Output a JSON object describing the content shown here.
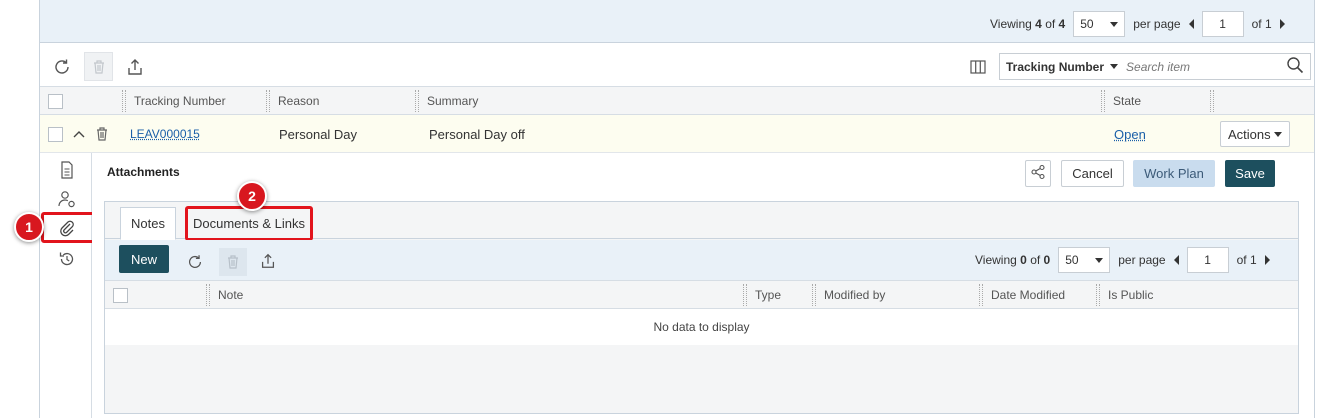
{
  "top_pager": {
    "viewing_prefix": "Viewing",
    "viewing_count": "4",
    "viewing_of": "of",
    "viewing_total": "4",
    "page_size": "50",
    "per_page": "per page",
    "page_number": "1",
    "of_pages": "of 1"
  },
  "search": {
    "field": "Tracking Number",
    "placeholder": "Search item"
  },
  "grid": {
    "columns": [
      "Tracking Number",
      "Reason",
      "Summary",
      "State"
    ],
    "rows": [
      {
        "tracking_number": "LEAV000015",
        "reason": "Personal Day",
        "summary": "Personal Day off",
        "state": "Open",
        "actions": "Actions"
      }
    ]
  },
  "detail": {
    "section_title": "Attachments",
    "cancel_label": "Cancel",
    "work_plan_label": "Work Plan",
    "save_label": "Save",
    "tabs": [
      "Notes",
      "Documents & Links"
    ],
    "new_label": "New",
    "pager": {
      "viewing_prefix": "Viewing",
      "viewing_count": "0",
      "viewing_of": "of",
      "viewing_total": "0",
      "page_size": "50",
      "per_page": "per page",
      "page_number": "1",
      "of_pages": "of 1"
    },
    "columns": [
      "Note",
      "Type",
      "Modified by",
      "Date Modified",
      "Is Public"
    ],
    "empty_text": "No data to display"
  },
  "callouts": [
    "1",
    "2"
  ],
  "colors": {
    "accent_dark": "#1d4f5e",
    "link": "#1a5fa8",
    "highlight": "#e2141c",
    "work_plan_bg": "#c9dcee"
  }
}
